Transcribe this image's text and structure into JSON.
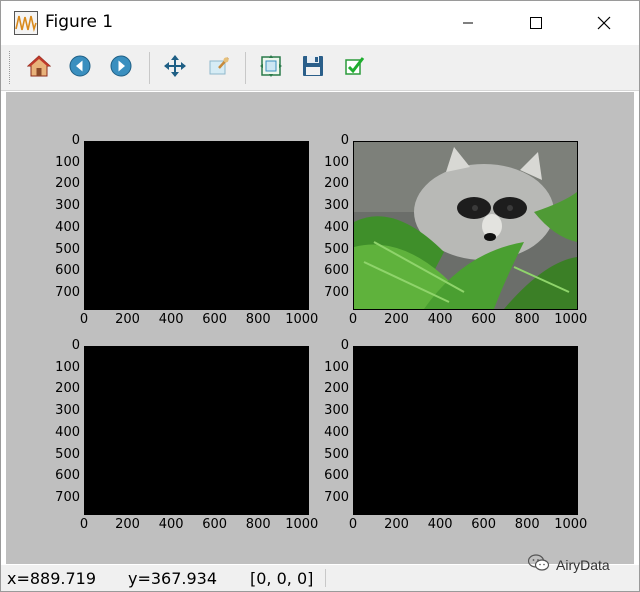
{
  "window": {
    "title": "Figure 1",
    "app_icon": "matplotlib-figure-icon",
    "controls": [
      "minimize-icon",
      "maximize-icon",
      "close-icon"
    ]
  },
  "toolbar": {
    "buttons": [
      {
        "name": "home",
        "icon": "home-icon"
      },
      {
        "name": "back",
        "icon": "back-arrow-icon"
      },
      {
        "name": "forward",
        "icon": "forward-arrow-icon"
      },
      {
        "name": "pan",
        "icon": "pan-move-icon"
      },
      {
        "name": "zoom",
        "icon": "zoom-rect-icon"
      },
      {
        "name": "subplots",
        "icon": "configure-subplots-icon"
      },
      {
        "name": "save",
        "icon": "save-floppy-icon"
      },
      {
        "name": "edit",
        "icon": "edit-checkmark-icon"
      }
    ]
  },
  "figure": {
    "background": "#bfbfbf",
    "subplots": [
      {
        "id": "top-left",
        "content": "black",
        "x_ticks": [
          "0",
          "200",
          "400",
          "600",
          "800",
          "1000"
        ],
        "y_ticks": [
          "0",
          "100",
          "200",
          "300",
          "400",
          "500",
          "600",
          "700"
        ]
      },
      {
        "id": "top-right",
        "content": "raccoon-face-image",
        "x_ticks": [
          "0",
          "200",
          "400",
          "600",
          "800",
          "1000"
        ],
        "y_ticks": [
          "0",
          "100",
          "200",
          "300",
          "400",
          "500",
          "600",
          "700"
        ]
      },
      {
        "id": "bottom-left",
        "content": "black",
        "x_ticks": [
          "0",
          "200",
          "400",
          "600",
          "800",
          "1000"
        ],
        "y_ticks": [
          "0",
          "100",
          "200",
          "300",
          "400",
          "500",
          "600",
          "700"
        ]
      },
      {
        "id": "bottom-right",
        "content": "black",
        "x_ticks": [
          "0",
          "200",
          "400",
          "600",
          "800",
          "1000"
        ],
        "y_ticks": [
          "0",
          "100",
          "200",
          "300",
          "400",
          "500",
          "600",
          "700"
        ]
      }
    ]
  },
  "status": {
    "x": "x=889.719",
    "y": "y=367.934",
    "pixel": "[0, 0, 0]"
  },
  "watermark": {
    "text": "AiryData",
    "icon": "wechat-icon"
  }
}
